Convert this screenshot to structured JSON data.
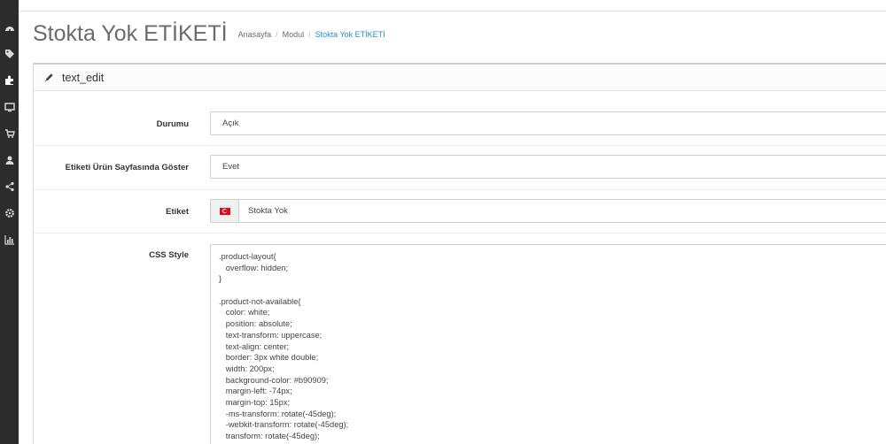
{
  "page": {
    "title": "Stokta Yok ETİKETİ"
  },
  "breadcrumb": [
    {
      "label": "Anasayfa"
    },
    {
      "label": "Modul"
    },
    {
      "label": "Stokta Yok ETİKETİ"
    }
  ],
  "sidebar": {
    "icons": [
      "dashboard-icon",
      "tag-icon",
      "puzzle-icon",
      "desktop-icon",
      "cart-icon",
      "user-icon",
      "share-icon",
      "cog-icon",
      "bar-chart-icon"
    ]
  },
  "panel": {
    "heading": "text_edit",
    "heading_icon": "pencil-icon"
  },
  "form": {
    "status": {
      "label": "Durumu",
      "value": "Açık"
    },
    "show_on_product": {
      "label": "Etiketi Ürün Sayfasında Göster",
      "value": "Evet"
    },
    "label": {
      "label": "Etiket",
      "value": "Stokta Yok",
      "flag": "tr-flag-icon"
    },
    "css_style": {
      "label": "CSS Style",
      "lines": [
        ".product-layout{",
        "   overflow: hidden;",
        "}",
        "",
        ".product-not-available{",
        "   color: white;",
        "   position: absolute;",
        "   text-transform: uppercase;",
        "   text-align: center;",
        "   border: 3px white double;",
        "   width: 200px;",
        "   background-color: #b90909;",
        "   margin-left: -74px;",
        "   margin-top: 15px;",
        "   -ms-transform: rotate(-45deg);",
        "   -webkit-transform: rotate(-45deg);",
        "   transform: rotate(-45deg);"
      ]
    }
  },
  "colors": {
    "sidebar_bg": "#2c2c2c",
    "accent_link": "#1e91cf",
    "flag_red": "#e30a17"
  }
}
